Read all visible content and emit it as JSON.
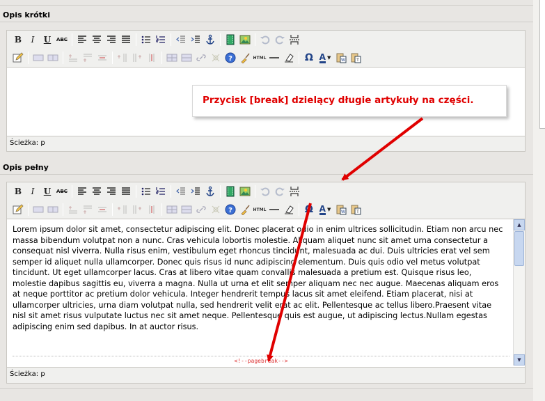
{
  "sections": {
    "short": {
      "title": "Opis krótki",
      "path_label": "Ścieżka: p"
    },
    "full": {
      "title": "Opis pełny",
      "path_label": "Ścieżka: p"
    }
  },
  "toolbar": {
    "bold": "B",
    "italic": "I",
    "underline": "U",
    "strike": "ABC",
    "html": "HTML",
    "omega": "Ω",
    "font_color": "A"
  },
  "callout": "Przycisk [break] dzielący długie artykuły na części.",
  "body_text": "Lorem ipsum dolor sit amet, consectetur adipiscing elit. Donec placerat odio in enim ultrices sollicitudin. Etiam non arcu nec massa bibendum volutpat non a nunc. Cras vehicula lobortis molestie. Aliquam aliquet nunc sit amet urna consectetur a consequat nisl viverra. Nulla risus enim, vestibulum eget rhoncus tincidunt, malesuada ac dui. Duis ultricies erat vel sem semper id aliquet nulla ullamcorper. Donec quis risus id nunc adipiscing elementum. Duis quis odio vel metus volutpat tincidunt. Ut eget ullamcorper lacus. Cras at libero vitae quam convallis malesuada a pretium est. Quisque risus leo, molestie dapibus sagittis eu, viverra a magna. Nulla ut urna et elit semper aliquam nec nec augue. Maecenas aliquam eros at neque porttitor ac pretium dolor vehicula. Integer hendrerit tempus lacus sit amet eleifend. Etiam placerat, nisi at ullamcorper ultricies, urna diam volutpat nulla, sed hendrerit velit erat ac elit. Pellentesque ac tellus libero.Praesent vitae nisl sit amet risus vulputate luctus nec sit amet neque. Pellentesque quis est augue, ut adipiscing lectus.Nullam egestas adipiscing enim sed dapibus. In at auctor risus.",
  "pagebreak_marker": "<!--pagebreak-->",
  "colors": {
    "annotation_red": "#e00000",
    "pagebreak_red": "#dd3333"
  }
}
